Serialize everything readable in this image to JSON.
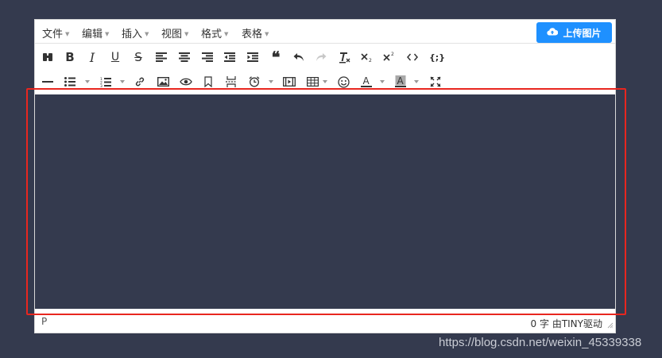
{
  "menubar": {
    "items": [
      {
        "label": "文件"
      },
      {
        "label": "编辑"
      },
      {
        "label": "插入"
      },
      {
        "label": "视图"
      },
      {
        "label": "格式"
      },
      {
        "label": "表格"
      }
    ],
    "upload_button": {
      "label": "上传图片",
      "icon": "cloud-upload-icon"
    }
  },
  "toolbar_row1": [
    "find-replace-icon",
    "bold-icon",
    "italic-icon",
    "underline-icon",
    "strikethrough-icon",
    "align-left-icon",
    "align-center-icon",
    "align-right-icon",
    "outdent-icon",
    "indent-icon",
    "blockquote-icon",
    "undo-icon",
    "redo-icon",
    "clear-format-icon",
    "subscript-icon",
    "superscript-icon",
    "code-icon",
    "code-sample-icon"
  ],
  "toolbar_row2": [
    "horizontal-rule-icon",
    "bullet-list-icon",
    "numbered-list-icon",
    "link-icon",
    "image-icon",
    "preview-icon",
    "bookmark-icon",
    "page-break-icon",
    "datetime-icon",
    "media-icon",
    "table-icon",
    "emoticon-icon",
    "text-color-icon",
    "background-color-icon",
    "fullscreen-icon"
  ],
  "statusbar": {
    "path": "P",
    "word_count": "0 字",
    "powered_by": "由TINY驱动"
  },
  "watermark": "https://blog.csdn.net/weixin_45339338",
  "colors": {
    "page_background": "#343a4e",
    "accent": "#1e90ff",
    "highlight": "#e8261f"
  }
}
